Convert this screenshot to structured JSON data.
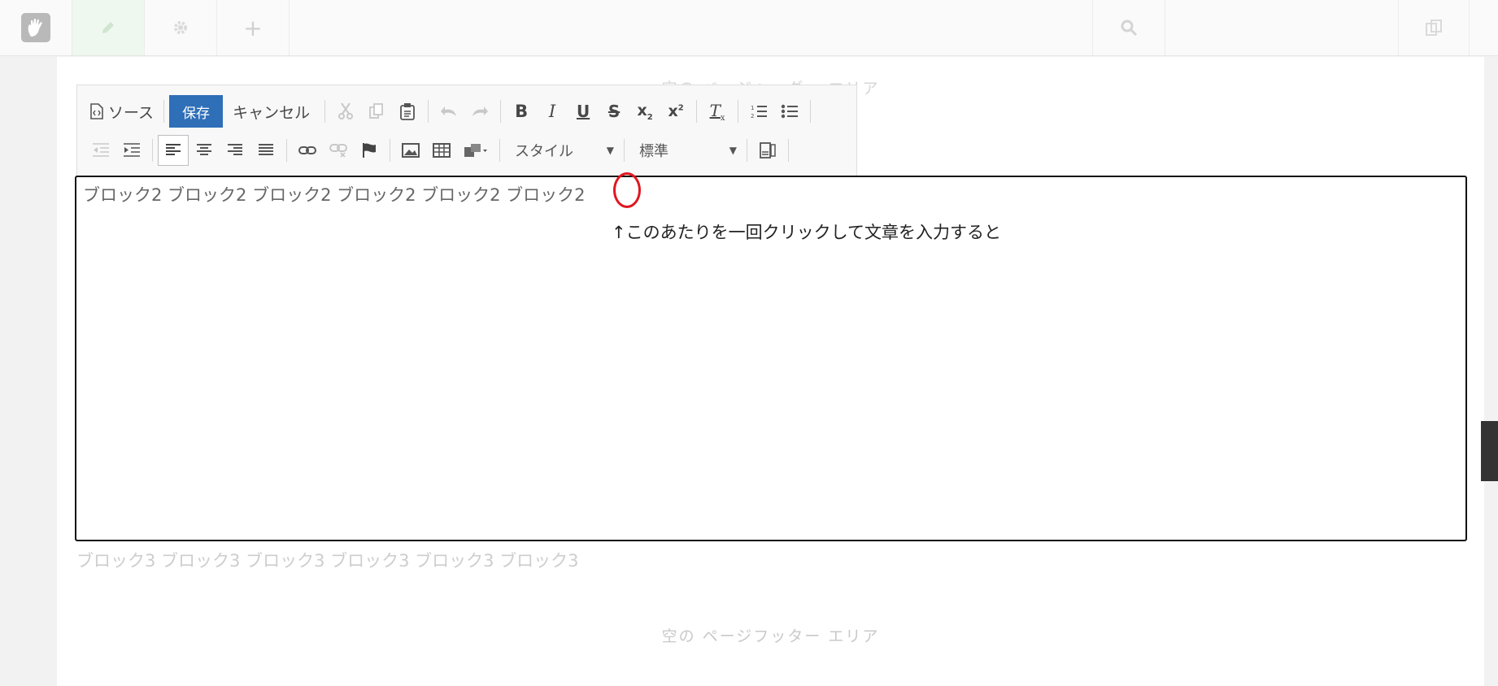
{
  "topbar": {
    "icons": [
      "concrete5-logo-icon",
      "pencil-icon",
      "gear-icon",
      "plus-icon",
      "search-icon",
      "copy-icon"
    ],
    "plus_glyph": "+"
  },
  "page": {
    "header_area": "空の ページヘッダー エリア",
    "block3_text": "ブロック3 ブロック3 ブロック3 ブロック3 ブロック3 ブロック3",
    "footer_area": "空の ページフッター エリア"
  },
  "toolbar": {
    "source_label": "ソース",
    "save_label": "保存",
    "cancel_label": "キャンセル",
    "style_select": "スタイル",
    "format_select": "標準",
    "save_color": "#2f6fb8"
  },
  "editor": {
    "content": "ブロック2 ブロック2 ブロック2 ブロック2 ブロック2 ブロック2",
    "annotation": "↑このあたりを一回クリックして文章を入力すると",
    "annotation_color": "#e0161f"
  }
}
